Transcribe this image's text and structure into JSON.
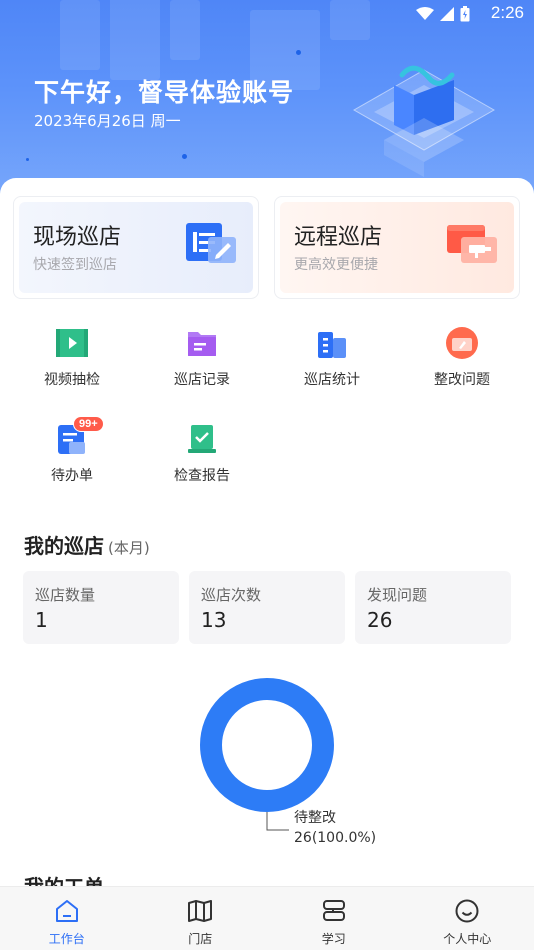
{
  "status_bar": {
    "time": "2:26"
  },
  "header": {
    "greeting": "下午好，督导体验账号",
    "date": "2023年6月26日 周一"
  },
  "cards": [
    {
      "title": "现场巡店",
      "subtitle": "快速签到巡店",
      "icon": "onsite-inspection-icon"
    },
    {
      "title": "远程巡店",
      "subtitle": "更高效更便捷",
      "icon": "remote-inspection-icon"
    }
  ],
  "shortcuts": [
    {
      "label": "视频抽检",
      "icon": "video-icon",
      "color": "#2fbf8a"
    },
    {
      "label": "巡店记录",
      "icon": "folder-icon",
      "color": "#a55cf0"
    },
    {
      "label": "巡店统计",
      "icon": "building-icon",
      "color": "#2d6ff6"
    },
    {
      "label": "整改问题",
      "icon": "rectify-icon",
      "color": "#ff6a4d"
    },
    {
      "label": "待办单",
      "icon": "todo-icon",
      "color": "#2d6ff6",
      "badge": "99+"
    },
    {
      "label": "检查报告",
      "icon": "report-icon",
      "color": "#2fbf8a"
    }
  ],
  "my_inspection": {
    "title": "我的巡店",
    "period": "(本月)",
    "stats": [
      {
        "label": "巡店数量",
        "value": "1"
      },
      {
        "label": "巡店次数",
        "value": "13"
      },
      {
        "label": "发现问题",
        "value": "26"
      }
    ]
  },
  "chart_data": {
    "type": "pie",
    "categories": [
      "待整改"
    ],
    "values": [
      26
    ],
    "percent_labels": [
      "26(100.0%)"
    ],
    "colors": [
      "#2d7cf6"
    ]
  },
  "work_orders": {
    "title": "我的工单"
  },
  "tabbar": [
    {
      "label": "工作台",
      "icon": "home-icon",
      "active": true
    },
    {
      "label": "门店",
      "icon": "map-icon",
      "active": false
    },
    {
      "label": "学习",
      "icon": "book-icon",
      "active": false
    },
    {
      "label": "个人中心",
      "icon": "smile-icon",
      "active": false
    }
  ],
  "colors": {
    "accent": "#2d6ff6",
    "donut": "#2d7cf6"
  }
}
